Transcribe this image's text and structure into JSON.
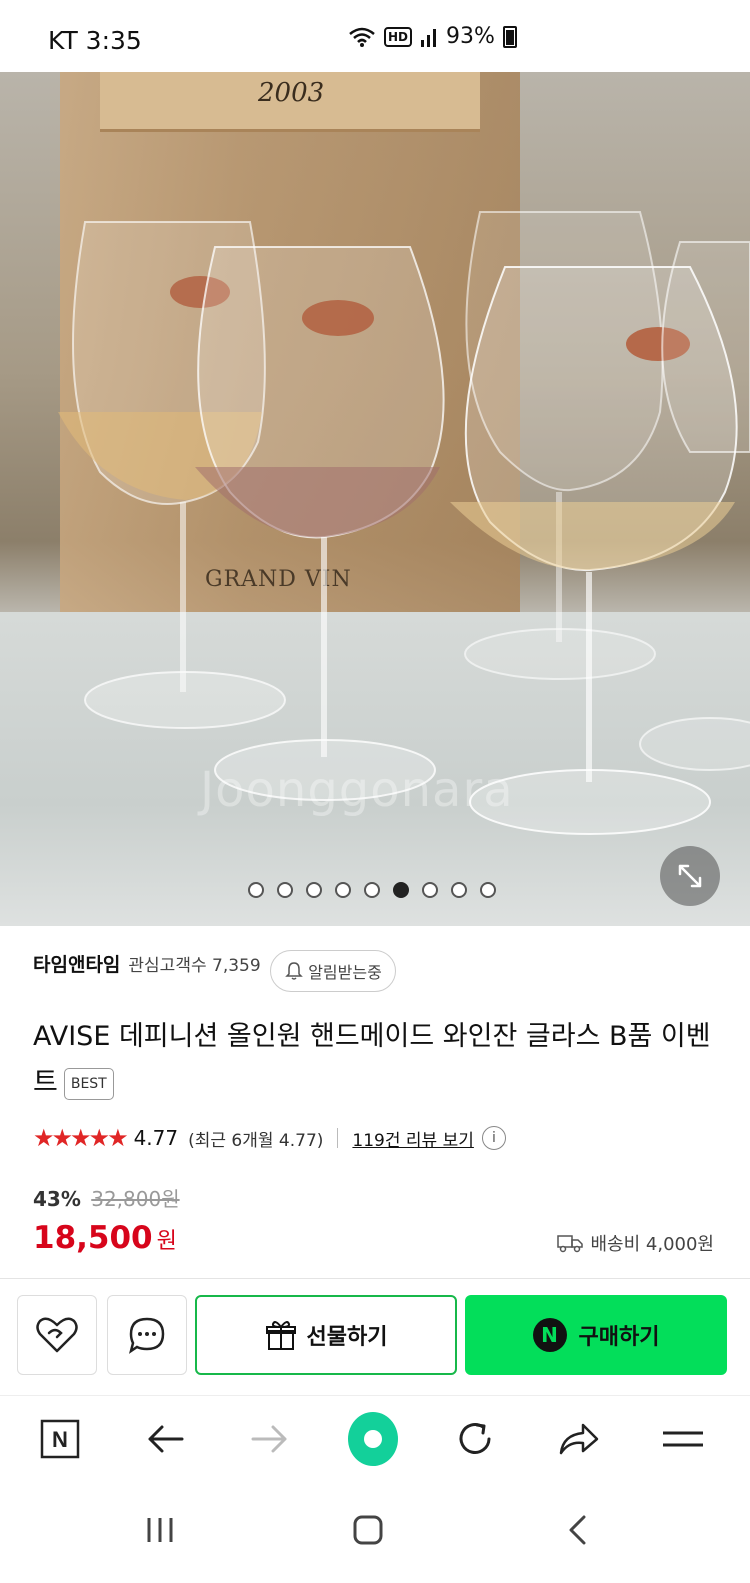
{
  "status_bar": {
    "carrier_time": "KT 3:35",
    "hd_label": "HD",
    "battery": "93%"
  },
  "gallery": {
    "total_images": 9,
    "active_index": 5,
    "crate_year": "2003",
    "crate_text": "GRAND VIN",
    "watermark": "Joonggonara"
  },
  "seller": {
    "name": "타임앤타임",
    "fans_label": "관심고객수 7,359",
    "alarm_label": "알림받는중"
  },
  "product": {
    "title": "AVISE 데피니션 올인원 핸드메이드 와인잔 글라스 B품 이벤트",
    "badge": "BEST"
  },
  "rating": {
    "stars": "★★★★★",
    "score": "4.77",
    "recent": "(최근 6개월 4.77)",
    "review_link": "119건 리뷰 보기",
    "info_icon": "i"
  },
  "price": {
    "discount_rate": "43%",
    "original": "32,800원",
    "sale": "18,500",
    "unit": "원",
    "shipping": "배송비 4,000원"
  },
  "actions": {
    "gift_label": "선물하기",
    "buy_label": "구매하기",
    "buy_logo": "N",
    "colors": {
      "buy_green": "#03de5a",
      "gift_border": "#17b84a",
      "price_red": "#d7051b"
    }
  },
  "browser_bar": {
    "home_logo": "N",
    "icons": [
      "naver-home-icon",
      "back-arrow-icon",
      "forward-arrow-icon",
      "green-dot-icon",
      "refresh-icon",
      "share-icon",
      "menu-icon"
    ]
  }
}
